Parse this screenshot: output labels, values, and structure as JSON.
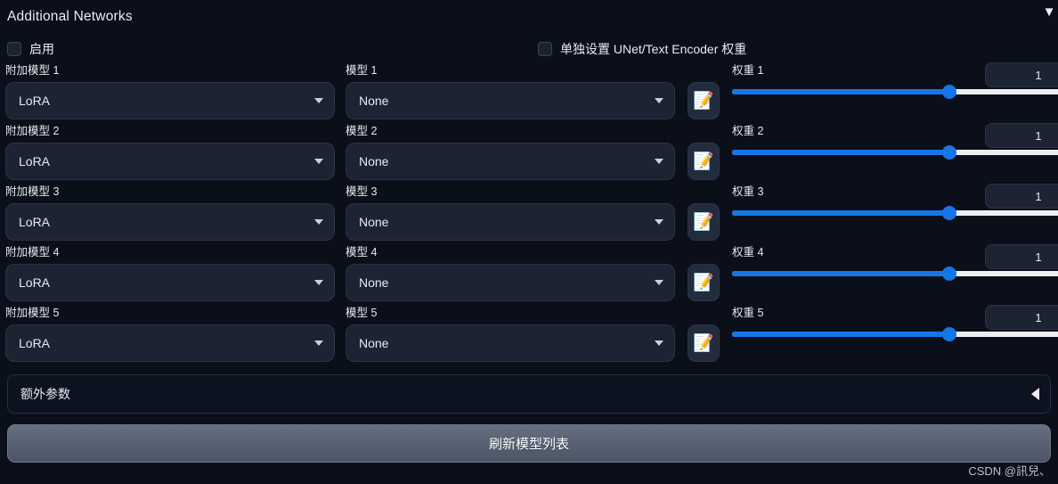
{
  "header": {
    "title": "Additional Networks",
    "collapse_icon": "chevron-down-icon",
    "collapse_glyph": "▼"
  },
  "options": {
    "enable_label": "启用",
    "enable_checked": false,
    "separate_unet_te_label": "单独设置 UNet/Text Encoder 权重",
    "separate_unet_te_checked": false
  },
  "colors": {
    "background": "#0b0f19",
    "field_bg": "#1c2433",
    "slider_fill": "#1676e8",
    "slider_track": "#eceef0",
    "button_gradient_top": "#667081",
    "button_gradient_bottom": "#4b5565"
  },
  "rows": [
    {
      "type_label": "附加模型 1",
      "type_value": "LoRA",
      "model_label": "模型 1",
      "model_value": "None",
      "edit_icon": "memo-icon",
      "edit_glyph": "📝",
      "weight_label": "权重 1",
      "weight_value": "1",
      "weight_percent": 58
    },
    {
      "type_label": "附加模型 2",
      "type_value": "LoRA",
      "model_label": "模型 2",
      "model_value": "None",
      "edit_icon": "memo-icon",
      "edit_glyph": "📝",
      "weight_label": "权重 2",
      "weight_value": "1",
      "weight_percent": 58
    },
    {
      "type_label": "附加模型 3",
      "type_value": "LoRA",
      "model_label": "模型 3",
      "model_value": "None",
      "edit_icon": "memo-icon",
      "edit_glyph": "📝",
      "weight_label": "权重 3",
      "weight_value": "1",
      "weight_percent": 58
    },
    {
      "type_label": "附加模型 4",
      "type_value": "LoRA",
      "model_label": "模型 4",
      "model_value": "None",
      "edit_icon": "memo-icon",
      "edit_glyph": "📝",
      "weight_label": "权重 4",
      "weight_value": "1",
      "weight_percent": 58
    },
    {
      "type_label": "附加模型 5",
      "type_value": "LoRA",
      "model_label": "模型 5",
      "model_value": "None",
      "edit_icon": "memo-icon",
      "edit_glyph": "📝",
      "weight_label": "权重 5",
      "weight_value": "1",
      "weight_percent": 58
    }
  ],
  "extra_params": {
    "title": "额外参数",
    "arrow_icon": "triangle-left-icon"
  },
  "refresh": {
    "label": "刷新模型列表"
  },
  "watermark": {
    "text": "CSDN @訊兒、"
  }
}
